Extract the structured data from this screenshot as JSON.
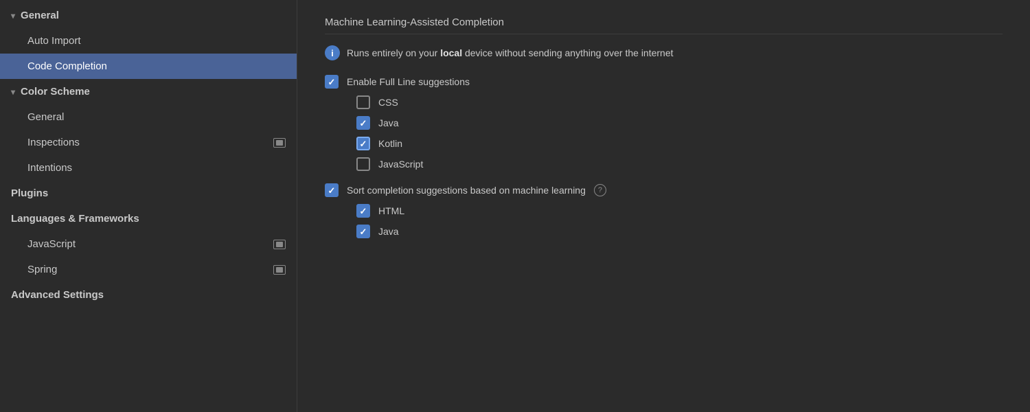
{
  "sidebar": {
    "sections": [
      {
        "id": "general",
        "label": "General",
        "type": "collapsible",
        "expanded": true,
        "children": [
          {
            "id": "auto-import",
            "label": "Auto Import",
            "selected": false,
            "hasIcon": false
          },
          {
            "id": "code-completion",
            "label": "Code Completion",
            "selected": true,
            "hasIcon": false
          }
        ]
      },
      {
        "id": "color-scheme",
        "label": "Color Scheme",
        "type": "collapsible",
        "expanded": true,
        "children": [
          {
            "id": "cs-general",
            "label": "General",
            "selected": false,
            "hasIcon": false
          },
          {
            "id": "inspections",
            "label": "Inspections",
            "selected": false,
            "hasIcon": true
          },
          {
            "id": "intentions",
            "label": "Intentions",
            "selected": false,
            "hasIcon": false
          }
        ]
      },
      {
        "id": "plugins",
        "label": "Plugins",
        "type": "header",
        "children": []
      },
      {
        "id": "languages-frameworks",
        "label": "Languages & Frameworks",
        "type": "header",
        "children": [
          {
            "id": "javascript",
            "label": "JavaScript",
            "selected": false,
            "hasIcon": true
          },
          {
            "id": "spring",
            "label": "Spring",
            "selected": false,
            "hasIcon": true
          }
        ]
      },
      {
        "id": "advanced-settings",
        "label": "Advanced Settings",
        "type": "header",
        "children": []
      }
    ]
  },
  "main": {
    "section_title": "Machine Learning-Assisted Completion",
    "info_text_pre": "Runs entirely on your ",
    "info_text_bold": "local",
    "info_text_post": " device without sending anything over the internet",
    "options": [
      {
        "id": "enable-full-line",
        "label": "Enable Full Line suggestions",
        "checked": true,
        "outlined": false,
        "indent": false,
        "subitems": [
          {
            "id": "css",
            "label": "CSS",
            "checked": false
          },
          {
            "id": "java",
            "label": "Java",
            "checked": true,
            "outlined": false
          },
          {
            "id": "kotlin",
            "label": "Kotlin",
            "checked": true,
            "outlined": true
          },
          {
            "id": "javascript",
            "label": "JavaScript",
            "checked": false
          }
        ]
      },
      {
        "id": "sort-completion",
        "label": "Sort completion suggestions based on machine learning",
        "checked": true,
        "outlined": false,
        "indent": false,
        "hasQuestion": true,
        "subitems": [
          {
            "id": "html",
            "label": "HTML",
            "checked": true,
            "outlined": false
          },
          {
            "id": "java2",
            "label": "Java",
            "checked": true,
            "outlined": false
          }
        ]
      }
    ]
  }
}
